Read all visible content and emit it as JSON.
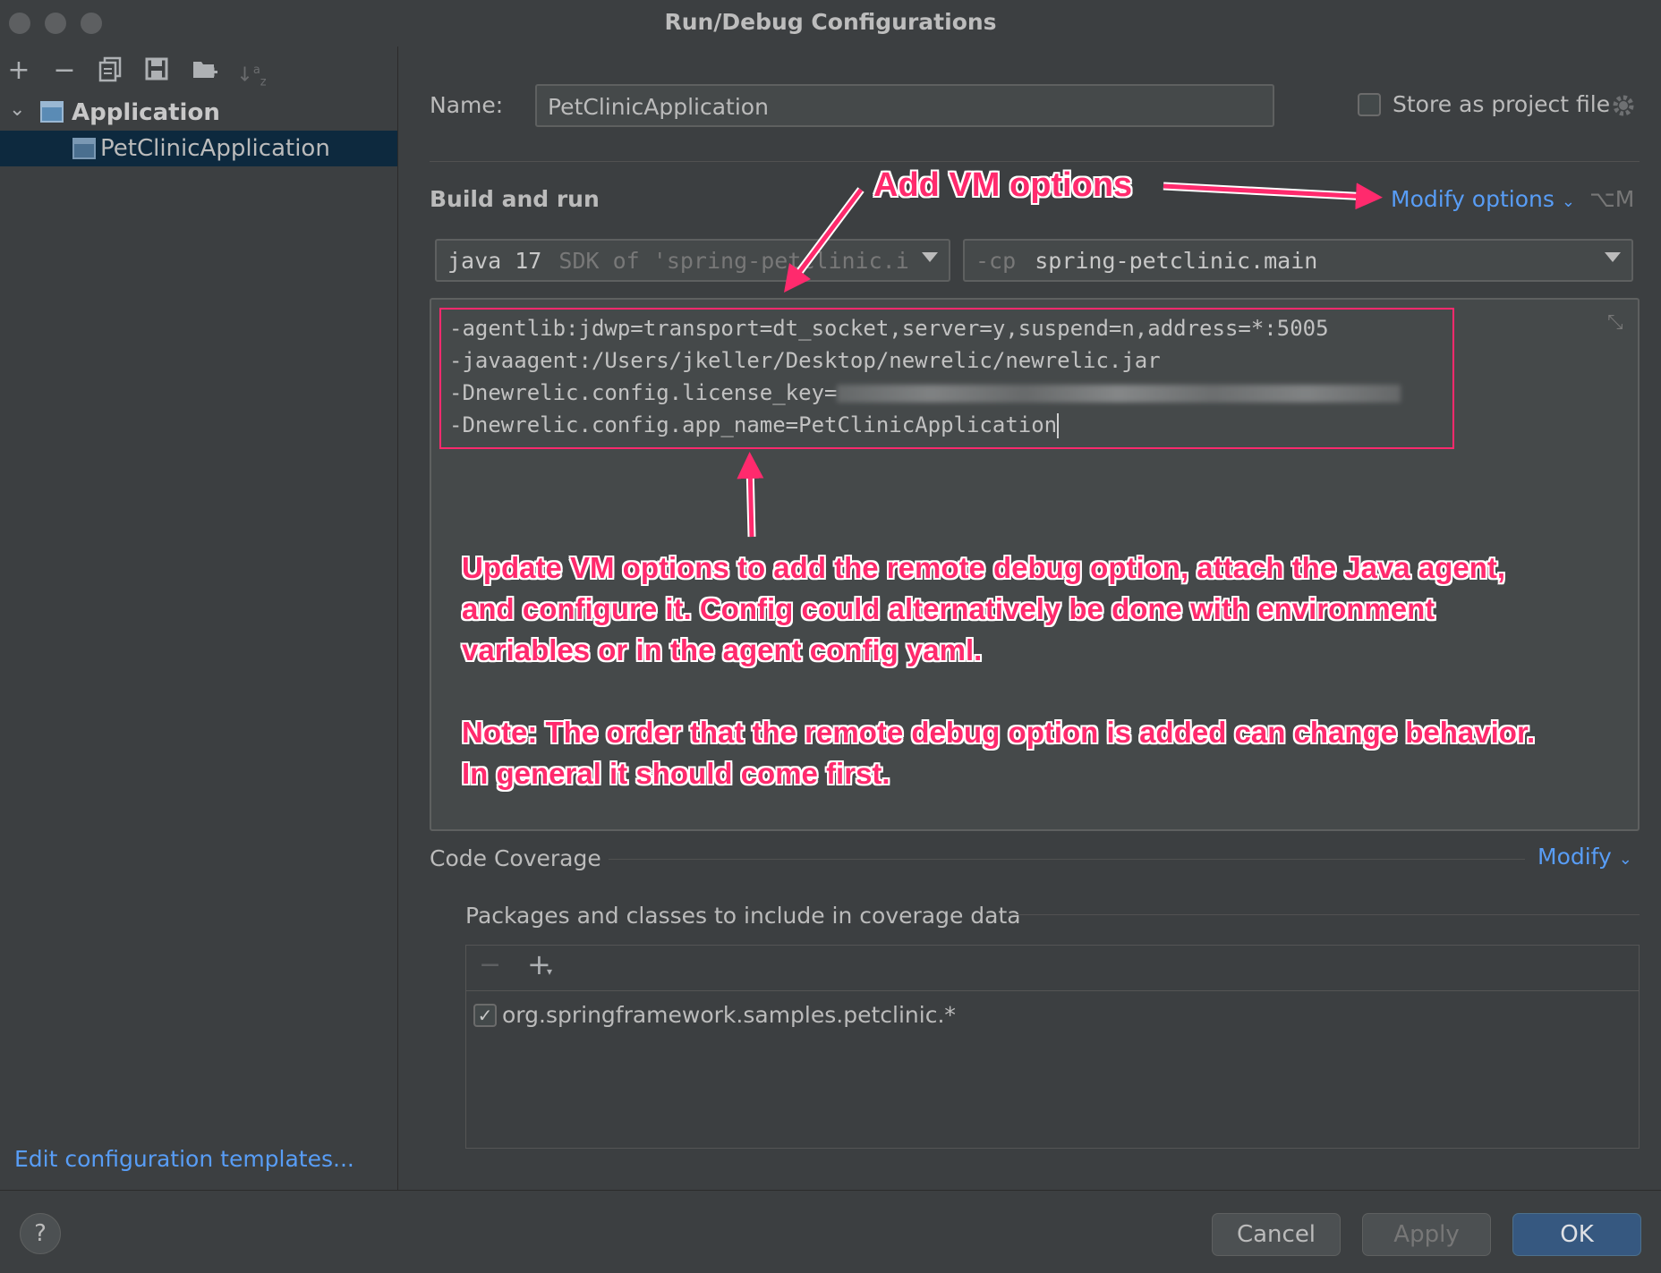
{
  "window": {
    "title": "Run/Debug Configurations"
  },
  "toolbar": {
    "icons": [
      "add-icon",
      "remove-icon",
      "copy-icon",
      "save-icon",
      "new-folder-icon",
      "sort-icon"
    ]
  },
  "tree": {
    "group_label": "Application",
    "item_label": "PetClinicApplication"
  },
  "left_footer": {
    "templates_link": "Edit configuration templates..."
  },
  "form": {
    "name_label": "Name:",
    "name_value": "PetClinicApplication",
    "store_label": "Store as project file",
    "build_run_label": "Build and run",
    "modify_options_label": "Modify options",
    "modify_shortcut": "⌥M",
    "jre_value": "java 17",
    "jre_hint": "SDK of 'spring-petclinic.i",
    "cp_prefix": "-cp",
    "cp_value": "spring-petclinic.main",
    "vm_options": [
      "-agentlib:jdwp=transport=dt_socket,server=y,suspend=n,address=*:5005",
      "-javaagent:/Users/jkeller/Desktop/newrelic/newrelic.jar",
      "-Dnewrelic.config.license_key=",
      "-Dnewrelic.config.app_name=PetClinicApplication"
    ],
    "code_coverage_label": "Code Coverage",
    "modify_label": "Modify",
    "packages_label": "Packages and classes to include in coverage data",
    "coverage_entry": "org.springframework.samples.petclinic.*"
  },
  "annotations": {
    "add_vm": "Add VM options",
    "update_line1": "Update VM options to add the remote debug option, attach the Java agent,",
    "update_line2": "and configure it. Config could alternatively be done with environment",
    "update_line3": "variables or in the agent config yaml.",
    "note_line1": "Note: The order that the remote debug option is added can change behavior.",
    "note_line2": "In general it should come first."
  },
  "buttons": {
    "help": "?",
    "cancel": "Cancel",
    "apply": "Apply",
    "ok": "OK"
  },
  "colors": {
    "accent": "#589df6",
    "annotation": "#ff2a6d",
    "selection": "#0d293e"
  }
}
